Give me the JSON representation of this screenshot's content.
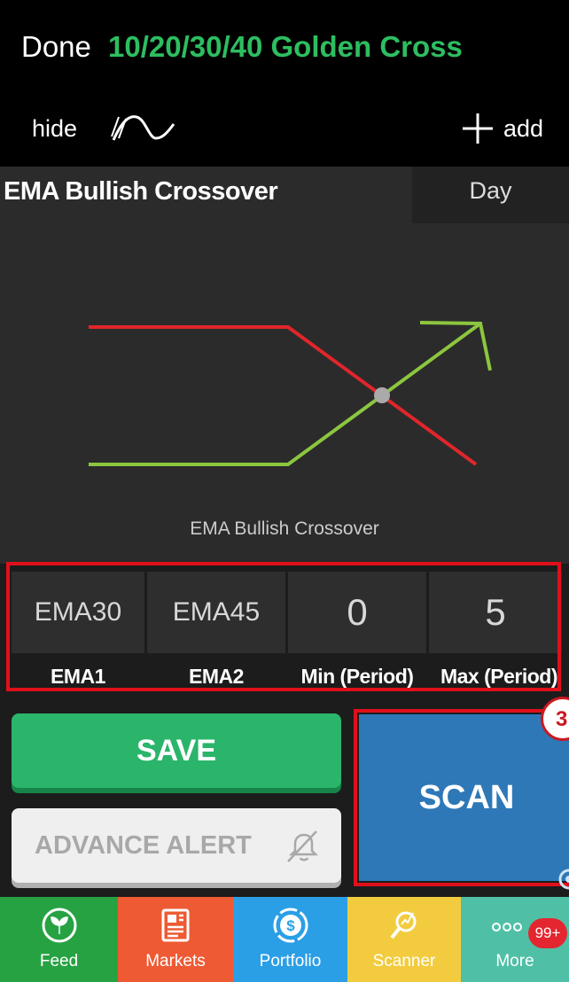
{
  "header": {
    "done_label": "Done",
    "scan_name": "10/20/30/40 Golden Cross",
    "hide_label": "hide",
    "hide_icon": "wave-curve-icon",
    "add_label": "add",
    "add_icon": "plus-icon"
  },
  "panel": {
    "title": "EMA Bullish Crossover",
    "timeframe": "Day",
    "diagram_caption": "EMA Bullish Crossover",
    "colors": {
      "bearish_line": "#e0262b",
      "bullish_line": "#8cc63f",
      "cross_point": "#aaaaaa"
    }
  },
  "params": [
    {
      "value": "EMA30",
      "label": "EMA1"
    },
    {
      "value": "EMA45",
      "label": "EMA2"
    },
    {
      "value": "0",
      "label": "Min (Period)"
    },
    {
      "value": "5",
      "label": "Max (Period)"
    }
  ],
  "actions": {
    "save_label": "SAVE",
    "alert_label": "ADVANCE ALERT",
    "alert_icon": "bell-off-icon",
    "scan_label": "SCAN",
    "step_badge": "3"
  },
  "nav": [
    {
      "label": "Feed",
      "icon": "feed-leaf-icon",
      "color": "#27a243"
    },
    {
      "label": "Markets",
      "icon": "newspaper-icon",
      "color": "#ee5a33"
    },
    {
      "label": "Portfolio",
      "icon": "dollar-circle-icon",
      "color": "#2b9fe6"
    },
    {
      "label": "Scanner",
      "icon": "magnifier-chart-icon",
      "color": "#f2cc3e"
    },
    {
      "label": "More",
      "icon": "more-dots-icon",
      "color": "#4fc0a6",
      "badge": "99+"
    }
  ]
}
